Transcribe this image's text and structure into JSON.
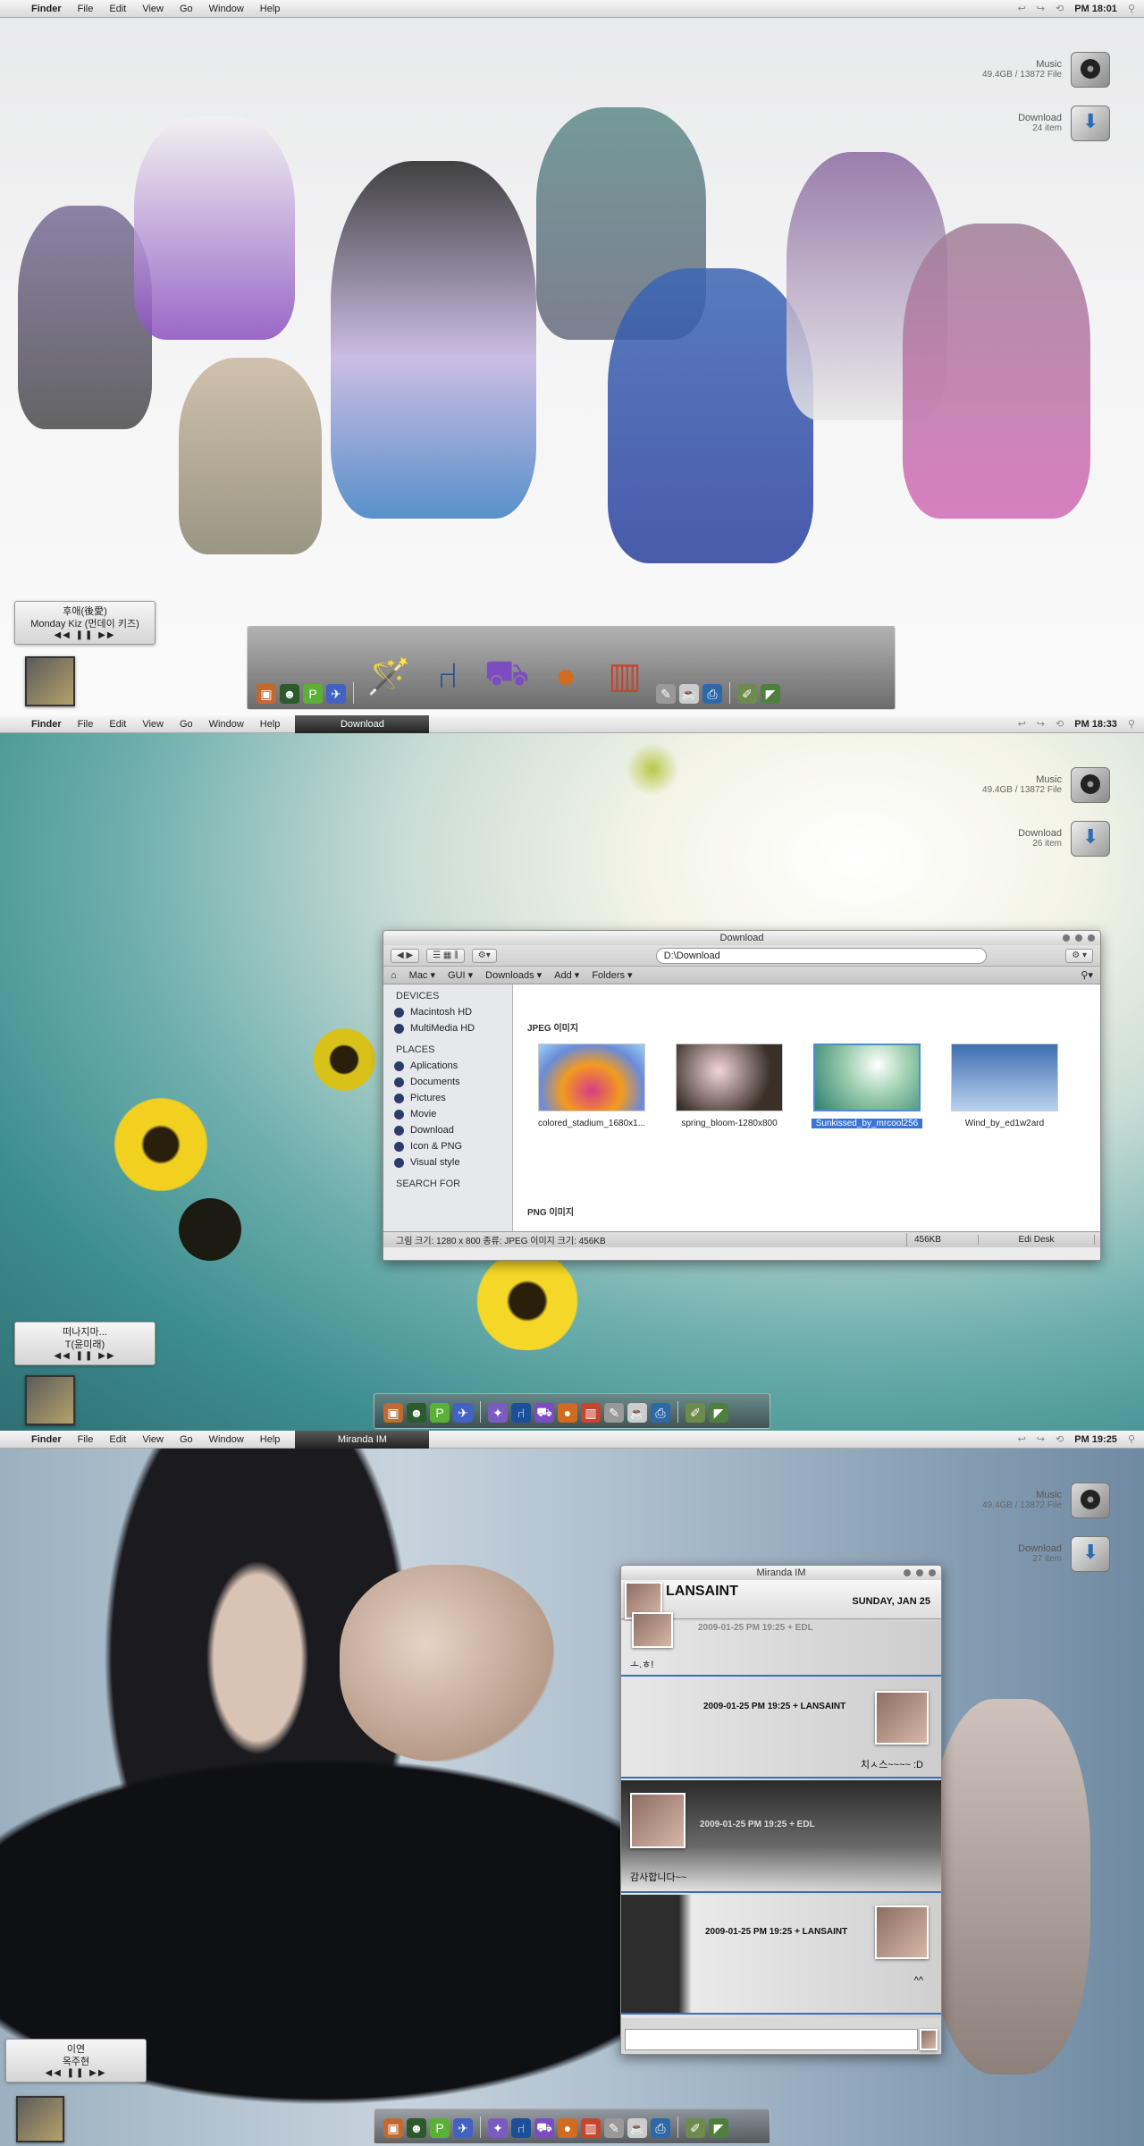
{
  "menu": {
    "apple": "",
    "items": [
      "Finder",
      "File",
      "Edit",
      "View",
      "Go",
      "Window",
      "Help"
    ],
    "right_icons": [
      "↩",
      "↪",
      "⟲"
    ]
  },
  "screens": [
    {
      "active_window": "",
      "clock": "PM 18:01",
      "drives": [
        {
          "name": "Music",
          "info": "49.4GB / 13872 File"
        },
        {
          "name": "Download",
          "info": "24  item"
        }
      ],
      "now_playing": {
        "title": "후애(後愛)",
        "artist": "Monday Kiz (먼데이 키즈)",
        "controls": "◀◀ ❚❚ ▶▶"
      }
    },
    {
      "active_window": "Download",
      "clock": "PM 18:33",
      "drives": [
        {
          "name": "Music",
          "info": "49.4GB / 13872 File"
        },
        {
          "name": "Download",
          "info": "26  item"
        }
      ],
      "now_playing": {
        "title": "떠나지마...",
        "artist": "T(윤미래)",
        "controls": "◀◀ ❚❚ ▶▶"
      }
    },
    {
      "active_window": "Miranda IM",
      "clock": "PM 19:25",
      "drives": [
        {
          "name": "Music",
          "info": "49.4GB / 13872 File"
        },
        {
          "name": "Download",
          "info": "27  item"
        }
      ],
      "now_playing": {
        "title": "이연",
        "artist": "옥주현",
        "controls": "◀◀ ❚❚ ▶▶"
      }
    }
  ],
  "finder": {
    "title": "Download",
    "path": "D:\\Download",
    "pathbar": [
      "Mac ▾",
      "GUI ▾",
      "Downloads ▾",
      "Add ▾",
      "Folders ▾"
    ],
    "devices_header": "DEVICES",
    "devices": [
      "Macintosh HD",
      "MultiMedia HD"
    ],
    "places_header": "PLACES",
    "places": [
      "Aplications",
      "Documents",
      "Pictures",
      "Movie",
      "Download",
      "Icon & PNG",
      "Visual style"
    ],
    "search_header": "SEARCH FOR",
    "group1": "JPEG 이미지",
    "group2": "PNG 이미지",
    "files": [
      {
        "name": "colored_stadium_1680x1...",
        "color": "#d83c86"
      },
      {
        "name": "spring_bloom-1280x800",
        "color": "#3a3028"
      },
      {
        "name": "Sunkissed_by_mrcool256",
        "color": "#5a9a72"
      },
      {
        "name": "Wind_by_ed1w2ard",
        "color": "#6d9ccc"
      }
    ],
    "status_info": "그림 크기: 1280 x 800 종류: JPEG 이미지 크기: 456KB",
    "status_size": "456KB",
    "status_location": "Edi Desk"
  },
  "miranda": {
    "title": "Miranda IM",
    "contact": "LANSAINT",
    "date": "SUNDAY, JAN 25",
    "messages": [
      {
        "header": "2009-01-25 PM 19:25 + EDL",
        "text": "ㅗ.ㅎ!"
      },
      {
        "header": "2009-01-25 PM 19:25 + LANSAINT",
        "text": "치ㅅ스~~~~ :D"
      },
      {
        "header": "2009-01-25 PM 19:25 + EDL",
        "text": "감사합니다~~"
      },
      {
        "header": "2009-01-25 PM 19:25 + LANSAINT",
        "text": "^^"
      }
    ]
  },
  "colors": {
    "accent": "#3875d7",
    "menubar": "#e4e4e4",
    "message_rule": "#3c6fb3"
  }
}
